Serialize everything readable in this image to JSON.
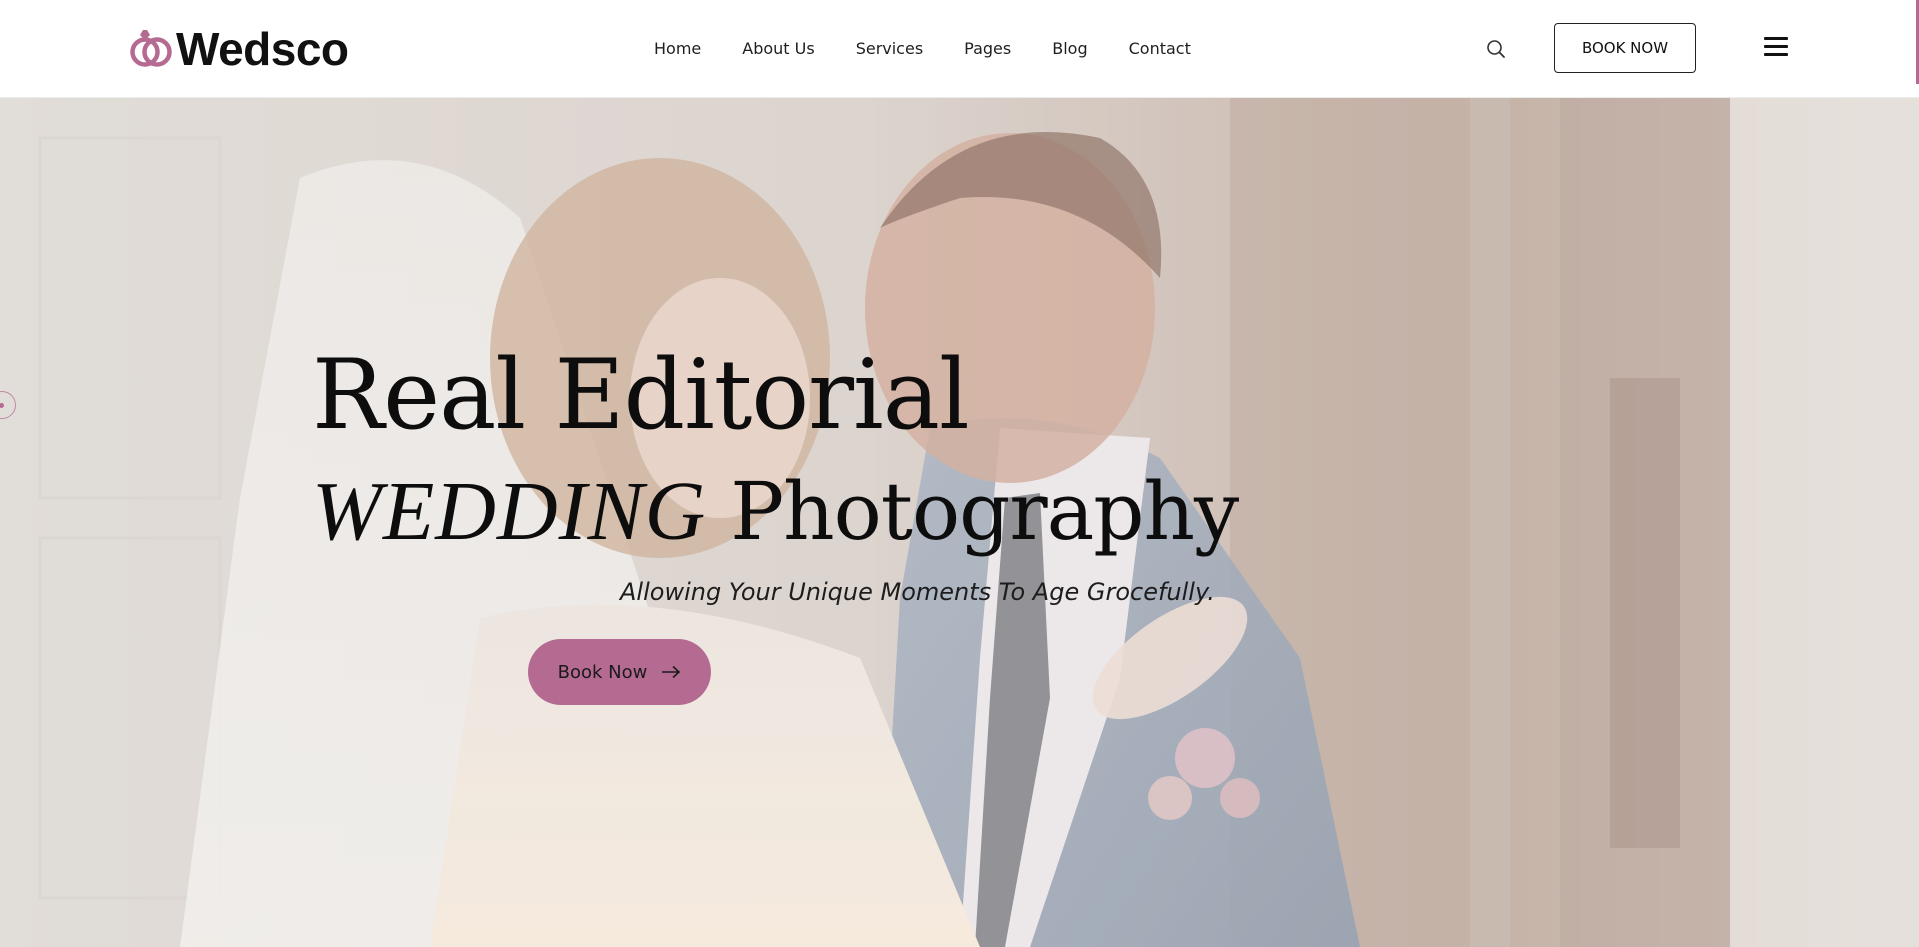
{
  "brand": {
    "name": "Wedsco",
    "accent_color": "#b56a92",
    "logo_icon": "rings-icon"
  },
  "nav": {
    "items": [
      {
        "label": "Home"
      },
      {
        "label": "About Us"
      },
      {
        "label": "Services"
      },
      {
        "label": "Pages"
      },
      {
        "label": "Blog"
      },
      {
        "label": "Contact"
      }
    ]
  },
  "header_actions": {
    "search_icon": "search-icon",
    "book_label": "BOOK NOW",
    "menu_icon": "hamburger-menu-icon"
  },
  "hero": {
    "title_line1": "Real Editorial",
    "title_line2_italic": "WEDDING",
    "title_line2_plain": "Photography",
    "tagline": "Allowing Your Unique Moments To Age Grocefully.",
    "cta_label": "Book Now",
    "cta_icon": "arrow-right-icon",
    "image_subject": "wedding-couple-photo"
  }
}
